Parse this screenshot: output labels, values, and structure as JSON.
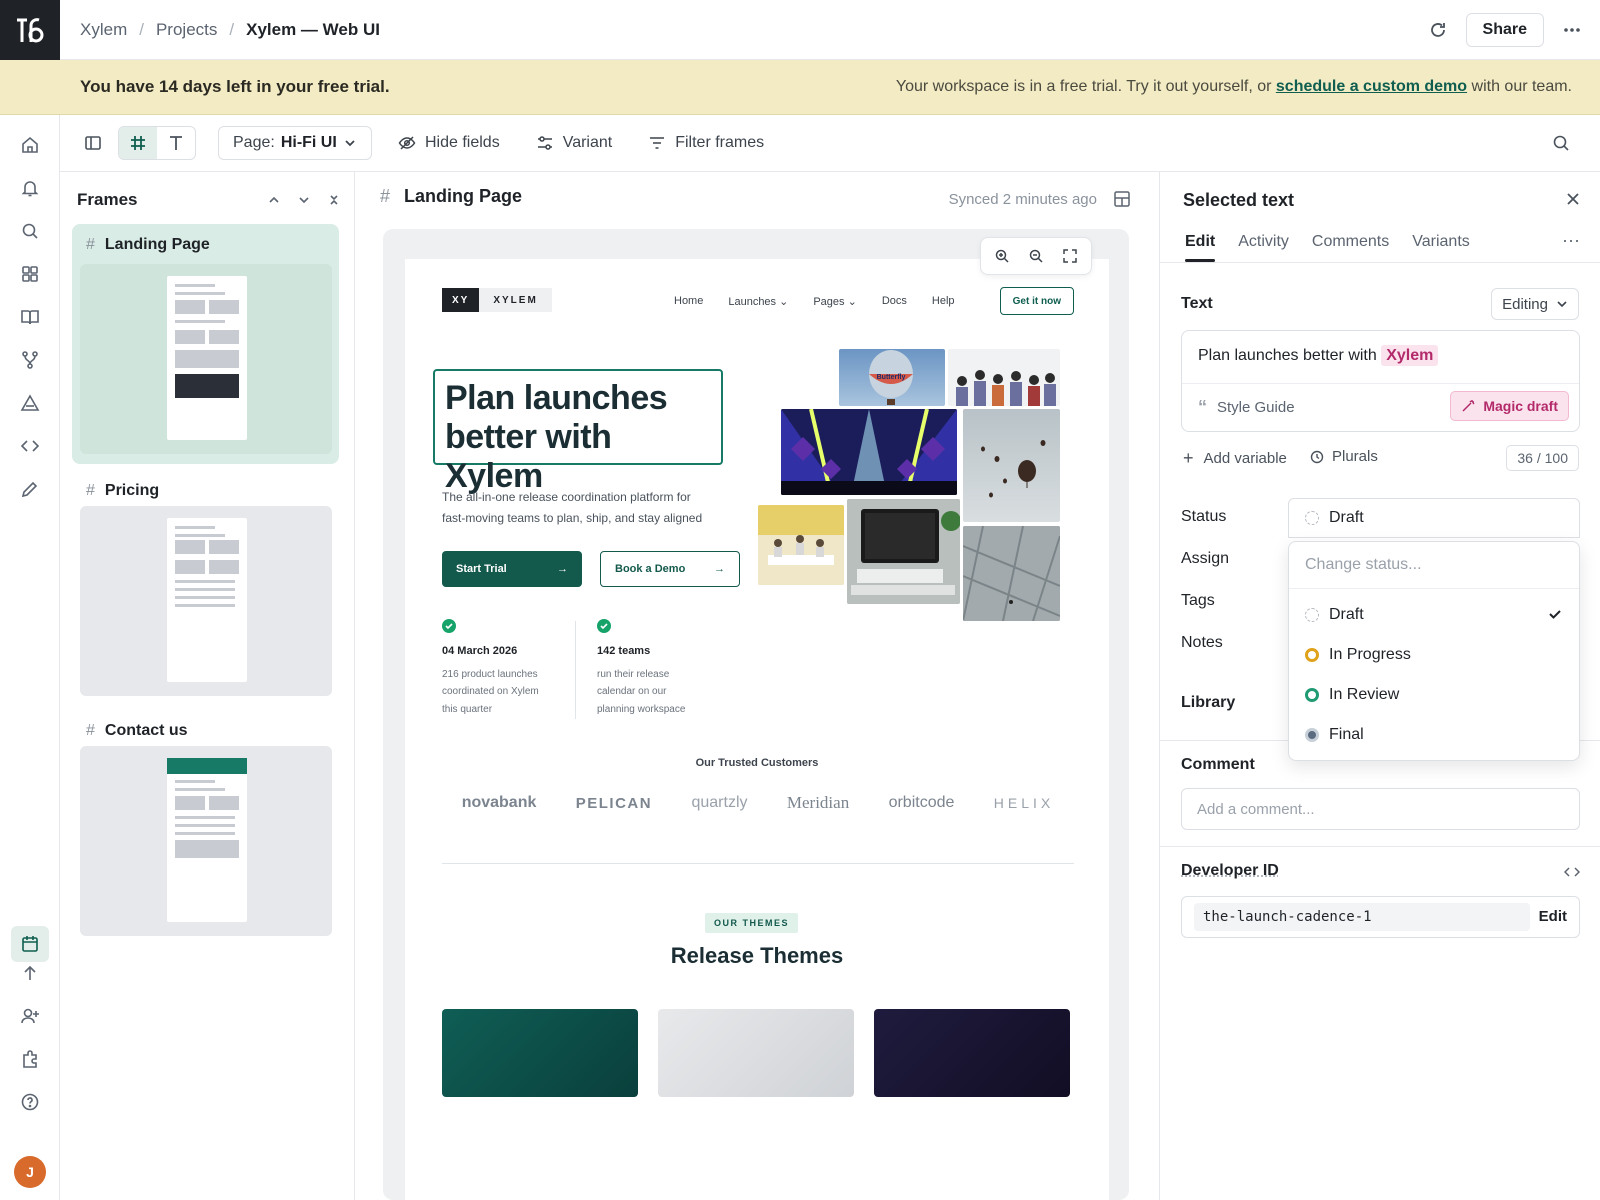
{
  "breadcrumb": {
    "items": [
      "Xylem",
      "Projects"
    ],
    "current": "Xylem — Web UI"
  },
  "header": {
    "share_label": "Share"
  },
  "trial_banner": {
    "left": "You have 14 days left in your free trial.",
    "right_prefix": "Your workspace is in a free trial. Try it out yourself, or",
    "link": "schedule a custom demo",
    "right_suffix": "with our team."
  },
  "toolbar": {
    "page_prefix": "Page:",
    "page_value": "Hi-Fi UI",
    "hide_fields": "Hide fields",
    "variant": "Variant",
    "filter_frames": "Filter frames"
  },
  "frames": {
    "title": "Frames",
    "items": [
      {
        "name": "Landing Page",
        "selected": true
      },
      {
        "name": "Pricing",
        "selected": false
      },
      {
        "name": "Contact us",
        "selected": false
      }
    ]
  },
  "canvas": {
    "frame_title": "Landing Page",
    "synced": "Synced 2 minutes ago"
  },
  "site": {
    "logo_mark": "XY",
    "logo_text": "XYLEM",
    "nav": [
      "Home",
      "Launches",
      "Pages",
      "Docs",
      "Help"
    ],
    "cta": "Get it now",
    "hero_line1": "Plan launches",
    "hero_line2": "better with Xylem",
    "sub_line1": "The all-in-one release coordination platform for",
    "sub_line2": "fast-moving teams to plan, ship, and stay aligned",
    "start_trial": "Start Trial",
    "book_demo": "Book a Demo",
    "stats": [
      {
        "title": "04 March 2026",
        "lines": [
          "216 product launches",
          "coordinated on Xylem",
          "this quarter"
        ]
      },
      {
        "title": "142 teams",
        "lines": [
          "run their release",
          "calendar on our",
          "planning workspace"
        ]
      }
    ],
    "trusted_title": "Our Trusted Customers",
    "customers": [
      "novabank",
      "PELICAN",
      "quartzly",
      "Meridian",
      "orbitcode",
      "HELIX"
    ],
    "themes_badge": "OUR THEMES",
    "themes_title": "Release Themes",
    "balloon_text": "Butterfly"
  },
  "panel": {
    "title": "Selected text",
    "tabs": [
      "Edit",
      "Activity",
      "Comments",
      "Variants"
    ],
    "text_label": "Text",
    "editing": "Editing",
    "text_value_prefix": "Plan launches better with",
    "text_value_highlight": "Xylem",
    "style_guide": "Style Guide",
    "magic_draft": "Magic draft",
    "add_variable": "Add variable",
    "plurals": "Plurals",
    "char_count": "36 / 100",
    "status_label": "Status",
    "status_value": "Draft",
    "assign_label": "Assign",
    "tags_label": "Tags",
    "notes_label": "Notes",
    "library_label": "Library",
    "dropdown": {
      "placeholder": "Change status...",
      "options": [
        {
          "label": "Draft",
          "color": "#c4c9cf",
          "selected": true
        },
        {
          "label": "In Progress",
          "color": "#e0a21b",
          "selected": false
        },
        {
          "label": "In Review",
          "color": "#1f9a73",
          "selected": false
        },
        {
          "label": "Final",
          "color": "#5b6b80",
          "selected": false
        }
      ]
    },
    "comment_label": "Comment",
    "comment_placeholder": "Add a comment...",
    "developer_id_label": "Developer ID",
    "developer_id": "the-launch-cadence-1",
    "developer_edit": "Edit"
  },
  "user": {
    "initial": "J"
  },
  "colors": {
    "accent": "#0f5e4f",
    "trial_bg": "#f2ebc4",
    "highlight": "#b32a6b"
  }
}
